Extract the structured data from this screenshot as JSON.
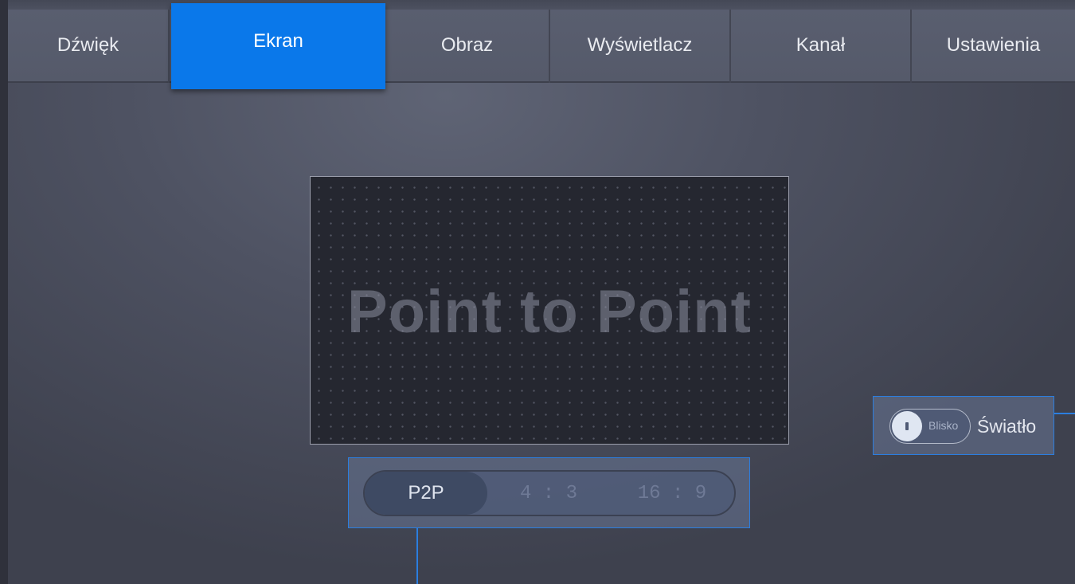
{
  "tabs": [
    {
      "label": "Dźwięk",
      "active": false
    },
    {
      "label": "Ekran",
      "active": true
    },
    {
      "label": "Obraz",
      "active": false
    },
    {
      "label": "Wyświetlacz",
      "active": false
    },
    {
      "label": "Kanał",
      "active": false
    },
    {
      "label": "Ustawienia",
      "active": false
    }
  ],
  "preview": {
    "text": "Point to Point"
  },
  "aspect_ratio": {
    "options": [
      "P2P",
      "4 : 3",
      "16 : 9"
    ],
    "selected": "P2P"
  },
  "light": {
    "label": "Światło",
    "toggle_value": "Blisko"
  },
  "colors": {
    "accent": "#0a78ea",
    "focus_border": "#2b7ee0",
    "background": "#4e5262"
  }
}
